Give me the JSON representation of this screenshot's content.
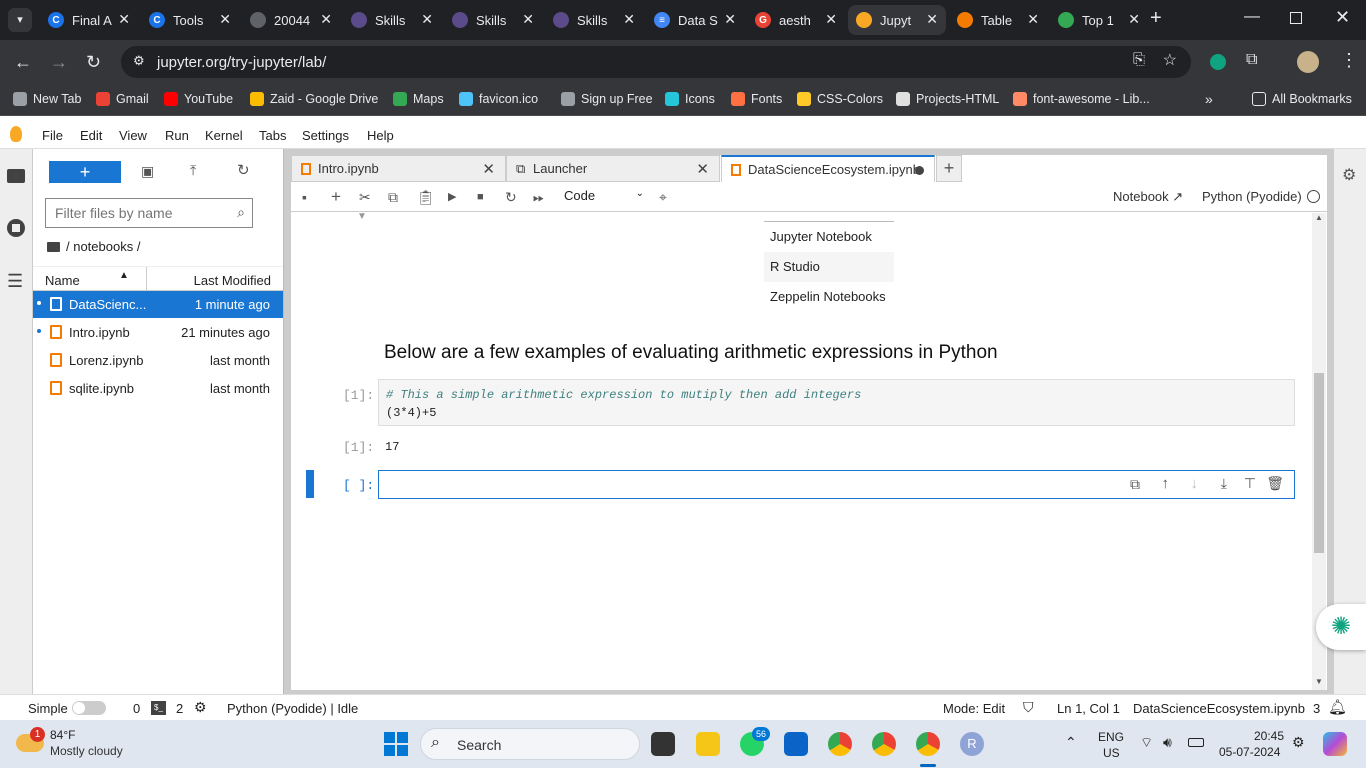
{
  "browser": {
    "tabs": [
      {
        "label": "Final A",
        "color": "#1a73e8",
        "glyph": "C"
      },
      {
        "label": "Tools",
        "color": "#1a73e8",
        "glyph": "C"
      },
      {
        "label": "20044",
        "color": "#5f6368",
        "glyph": ""
      },
      {
        "label": "Skills",
        "color": "#5b4b8a",
        "glyph": ""
      },
      {
        "label": "Skills",
        "color": "#5b4b8a",
        "glyph": ""
      },
      {
        "label": "Skills",
        "color": "#5b4b8a",
        "glyph": ""
      },
      {
        "label": "Data S",
        "color": "#4285f4",
        "glyph": "≡"
      },
      {
        "label": "aesth",
        "color": "#ea4335",
        "glyph": "G"
      },
      {
        "label": "Jupyt",
        "color": "#f9a825",
        "glyph": ""
      },
      {
        "label": "Table",
        "color": "#f57c00",
        "glyph": ""
      },
      {
        "label": "Top 1",
        "color": "#34a853",
        "glyph": ""
      }
    ],
    "url": "jupyter.org/try-jupyter/lab/",
    "bookmarks": [
      {
        "label": "New Tab",
        "color": "#9aa0a6"
      },
      {
        "label": "Gmail",
        "color": "#ea4335"
      },
      {
        "label": "YouTube",
        "color": "#ff0000"
      },
      {
        "label": "Zaid - Google Drive",
        "color": "#fbbc04"
      },
      {
        "label": "Maps",
        "color": "#34a853"
      },
      {
        "label": "favicon.ico",
        "color": "#4fc3f7"
      },
      {
        "label": "Sign up Free",
        "color": "#9aa0a6"
      },
      {
        "label": "Icons",
        "color": "#26c6da"
      },
      {
        "label": "Fonts",
        "color": "#ff7043"
      },
      {
        "label": "CSS-Colors",
        "color": "#ffca28"
      },
      {
        "label": "Projects-HTML",
        "color": "#e0e0e0"
      },
      {
        "label": "font-awesome - Lib...",
        "color": "#ff8a65"
      }
    ],
    "all_bookmarks": "All Bookmarks"
  },
  "menu": [
    "File",
    "Edit",
    "View",
    "Run",
    "Kernel",
    "Tabs",
    "Settings",
    "Help"
  ],
  "filebrowser": {
    "filter_placeholder": "Filter files by name",
    "path": "/ notebooks /",
    "col_name": "Name",
    "col_modified": "Last Modified",
    "files": [
      {
        "name": "DataScienc...",
        "modified": "1 minute ago",
        "selected": true,
        "running": true
      },
      {
        "name": "Intro.ipynb",
        "modified": "21 minutes ago",
        "selected": false,
        "running": true
      },
      {
        "name": "Lorenz.ipynb",
        "modified": "last month",
        "selected": false,
        "running": false
      },
      {
        "name": "sqlite.ipynb",
        "modified": "last month",
        "selected": false,
        "running": false
      }
    ]
  },
  "doctabs": [
    {
      "label": "Intro.ipynb"
    },
    {
      "label": "Launcher"
    },
    {
      "label": "DataScienceEcosystem.ipynb"
    }
  ],
  "toolbar": {
    "cell_type": "Code",
    "notebook_label": "Notebook",
    "kernel": "Python (Pyodide)"
  },
  "notebook": {
    "table_rows": [
      "Jupyter Notebook",
      "R Studio",
      "Zeppelin Notebooks"
    ],
    "heading": "Below are a few examples of evaluating arithmetic expressions in Python",
    "cell1_prompt": "[1]:",
    "cell1_comment": "# This a simple arithmetic expression to mutiply then add integers",
    "cell1_code": "(3*4)+5",
    "out1_prompt": "[1]:",
    "out1_value": "17",
    "cell2_prompt": "[ ]:"
  },
  "status": {
    "simple": "Simple",
    "terminals": "0",
    "kernels": "2",
    "kernel_status": "Python (Pyodide) | Idle",
    "mode": "Mode: Edit",
    "cursor": "Ln 1, Col 1",
    "filename": "DataScienceEcosystem.ipynb",
    "notifications": "3"
  },
  "taskbar": {
    "weather_temp": "84°F",
    "weather_desc": "Mostly cloudy",
    "weather_badge": "1",
    "search": "Search",
    "whatsapp_badge": "56",
    "lang1": "ENG",
    "lang2": "US",
    "time": "20:45",
    "date": "05-07-2024"
  }
}
